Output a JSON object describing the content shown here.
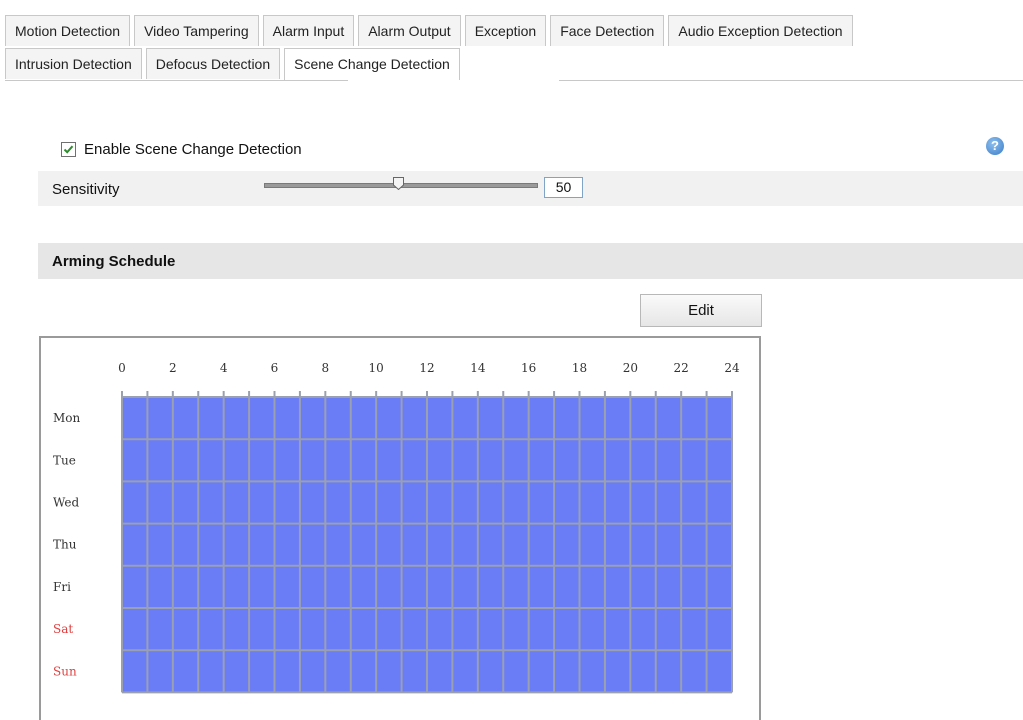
{
  "tabs": {
    "row1": [
      "Motion Detection",
      "Video Tampering",
      "Alarm Input",
      "Alarm Output",
      "Exception",
      "Face Detection",
      "Audio Exception Detection"
    ],
    "row2": [
      "Intrusion Detection",
      "Defocus Detection",
      "Scene Change Detection"
    ],
    "active": "Scene Change Detection"
  },
  "enable": {
    "label": "Enable Scene Change Detection",
    "checked": true
  },
  "help_icon": {
    "glyph": "?",
    "icon": "help-icon"
  },
  "sensitivity": {
    "label": "Sensitivity",
    "value": "50",
    "slider_fraction": 0.5
  },
  "arming_schedule": {
    "title": "Arming Schedule",
    "edit_label": "Edit",
    "hours": [
      "0",
      "2",
      "4",
      "6",
      "8",
      "10",
      "12",
      "14",
      "16",
      "18",
      "20",
      "22",
      "24"
    ],
    "days": [
      {
        "label": "Mon",
        "weekend": false
      },
      {
        "label": "Tue",
        "weekend": false
      },
      {
        "label": "Wed",
        "weekend": false
      },
      {
        "label": "Thu",
        "weekend": false
      },
      {
        "label": "Fri",
        "weekend": false
      },
      {
        "label": "Sat",
        "weekend": true
      },
      {
        "label": "Sun",
        "weekend": true
      }
    ],
    "armed_hours": "all",
    "colors": {
      "armed": "#6b7cf7",
      "grid": "#9aa0b0",
      "weekend_label": "#e04040",
      "weekday_label": "#333333"
    }
  }
}
